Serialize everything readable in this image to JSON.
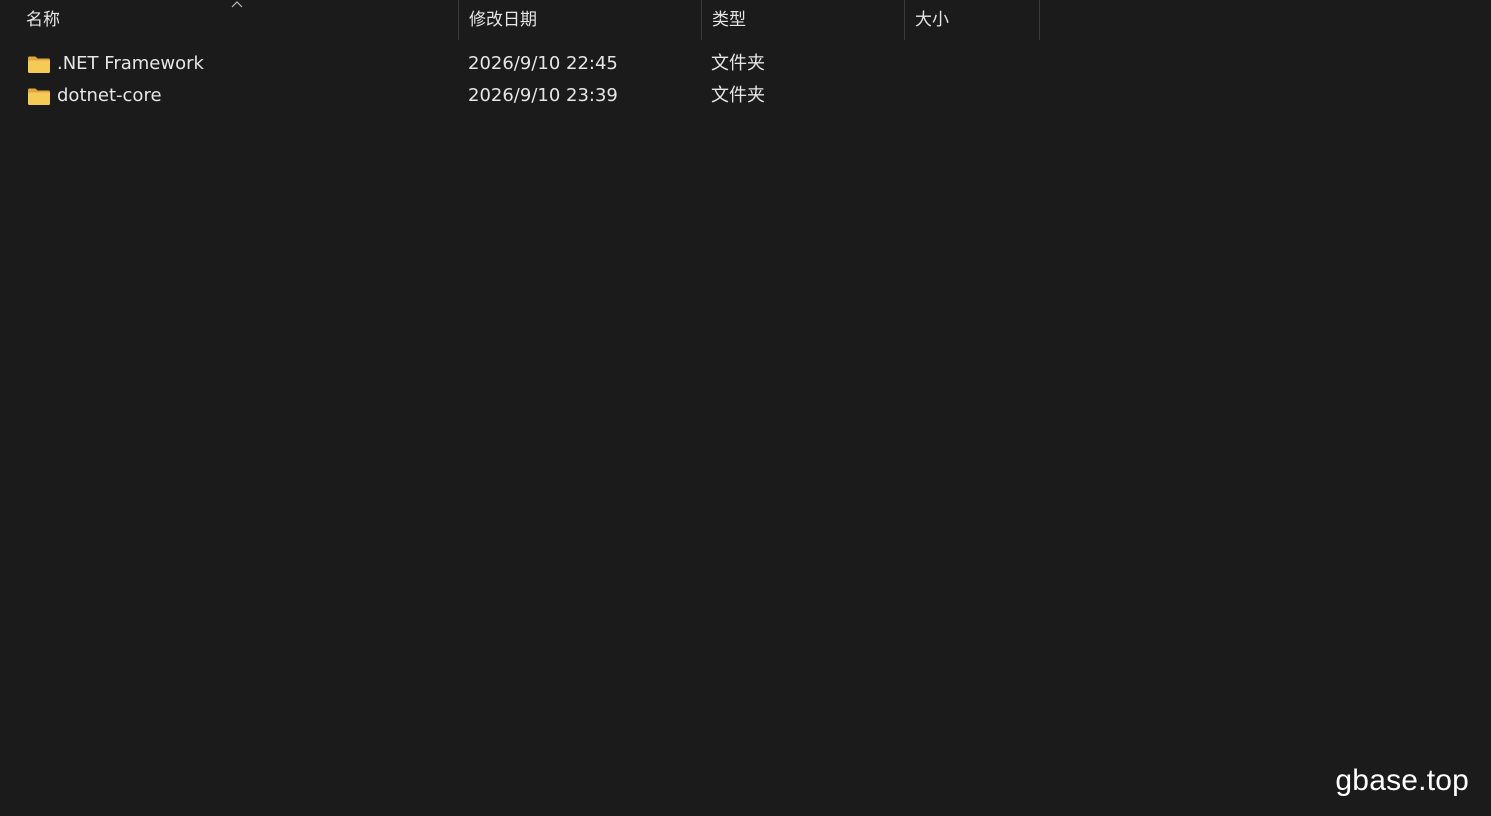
{
  "columns": {
    "name": "名称",
    "modified": "修改日期",
    "type": "类型",
    "size": "大小"
  },
  "sort": {
    "column": "name",
    "direction": "ascending",
    "icon": "chevron-up-icon"
  },
  "files": [
    {
      "icon": "folder-icon",
      "name": ".NET Framework",
      "modified": "2026/9/10 22:45",
      "type": "文件夹",
      "size": ""
    },
    {
      "icon": "folder-icon",
      "name": "dotnet-core",
      "modified": "2026/9/10 23:39",
      "type": "文件夹",
      "size": ""
    }
  ],
  "watermark": "gbase.top",
  "colors": {
    "background": "#1b1b1b",
    "text": "#e6e6e6",
    "folder": "#f2c94c"
  }
}
